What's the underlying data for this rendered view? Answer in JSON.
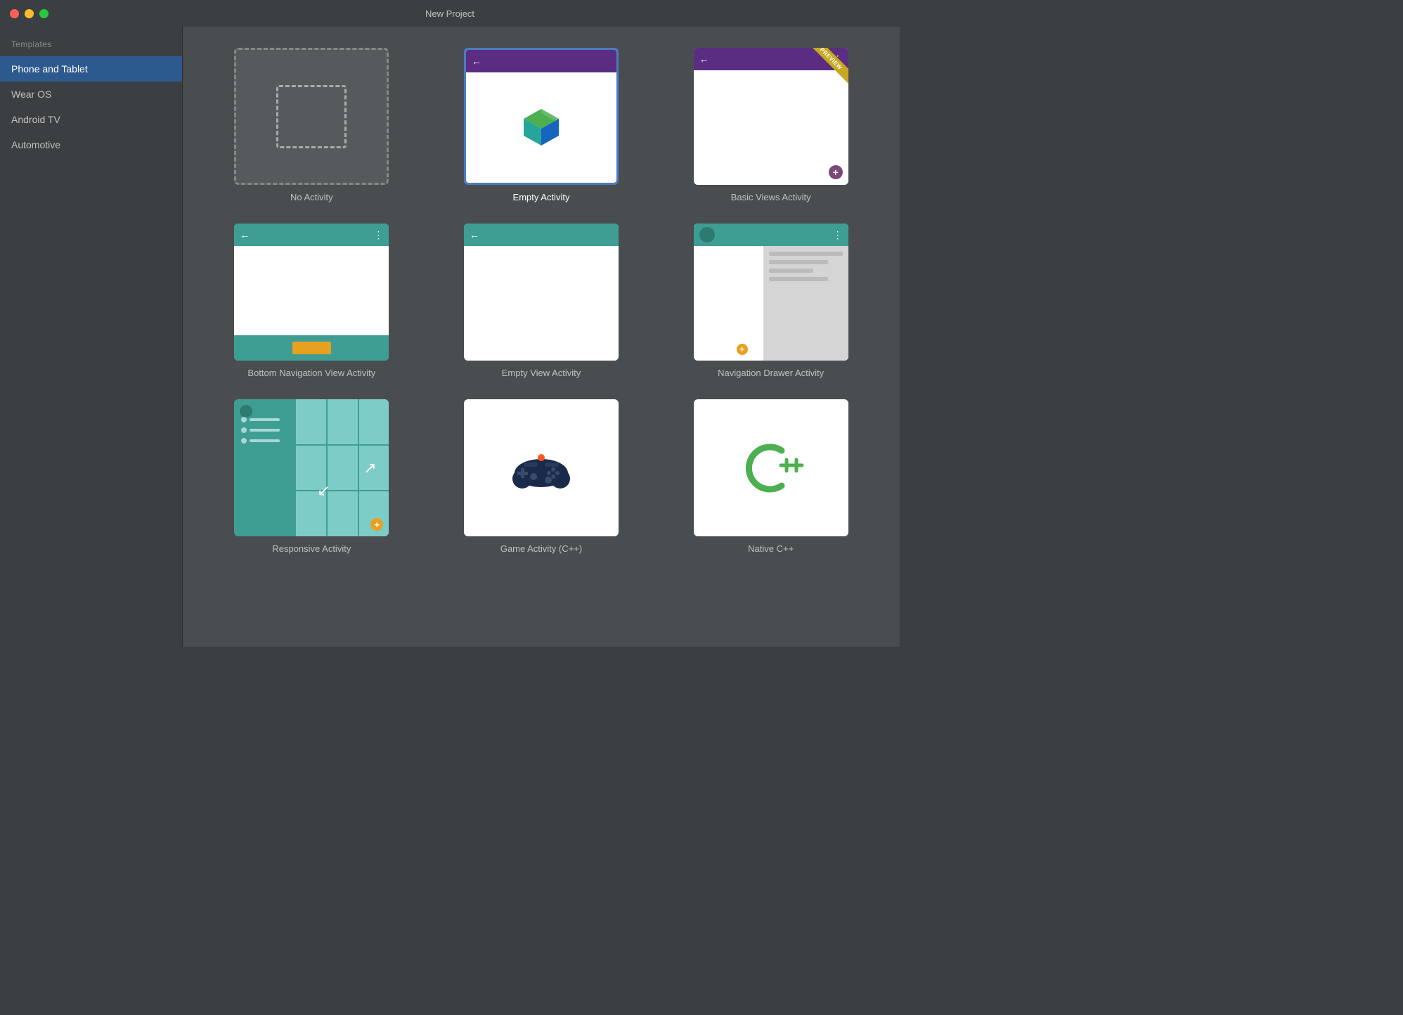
{
  "window": {
    "title": "New Project"
  },
  "sidebar": {
    "section_label": "Templates",
    "items": [
      {
        "id": "phone-tablet",
        "label": "Phone and Tablet",
        "active": true
      },
      {
        "id": "wear-os",
        "label": "Wear OS",
        "active": false
      },
      {
        "id": "android-tv",
        "label": "Android TV",
        "active": false
      },
      {
        "id": "automotive",
        "label": "Automotive",
        "active": false
      }
    ]
  },
  "templates": {
    "items": [
      {
        "id": "no-activity",
        "label": "No Activity"
      },
      {
        "id": "empty-activity",
        "label": "Empty Activity",
        "selected": true
      },
      {
        "id": "basic-views-activity",
        "label": "Basic Views Activity"
      },
      {
        "id": "bottom-navigation-view-activity",
        "label": "Bottom Navigation View Activity"
      },
      {
        "id": "empty-view-activity",
        "label": "Empty View Activity"
      },
      {
        "id": "navigation-drawer-activity",
        "label": "Navigation Drawer Activity"
      },
      {
        "id": "responsive-activity",
        "label": "Responsive Activity"
      },
      {
        "id": "game-activity",
        "label": "Game Activity (C++)"
      },
      {
        "id": "native-cpp",
        "label": "Native C++"
      }
    ]
  }
}
